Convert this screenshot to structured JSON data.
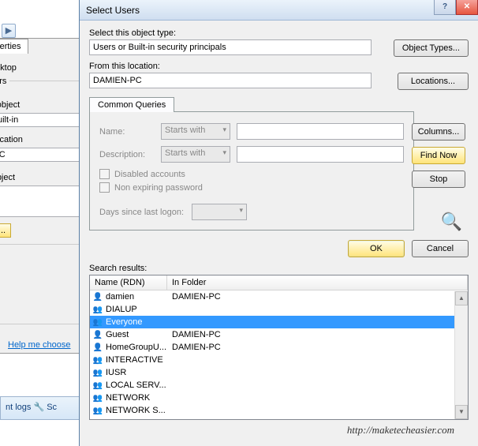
{
  "background": {
    "arrow": "▶",
    "sysprop_tab": "ystem Properties",
    "remote_label": "Remote Desktop",
    "select_users_group": "Select Users",
    "obj_label": "Select this object",
    "obj_value": "Users or Built-in",
    "loc_label": "From this location",
    "loc_value": "DAMIEN-PC",
    "enter_label": "Enter the object",
    "advanced_btn": "Advanced...",
    "help_link": "Help me choose",
    "logs_text": "nt logs     🔧 Sc"
  },
  "dialog": {
    "title": "Select Users",
    "object_type_label": "Select this object type:",
    "object_type_value": "Users or Built-in security principals",
    "object_types_btn": "Object Types...",
    "location_label": "From this location:",
    "location_value": "DAMIEN-PC",
    "locations_btn": "Locations...",
    "queries_tab": "Common Queries",
    "name_label": "Name:",
    "name_mode": "Starts with",
    "desc_label": "Description:",
    "desc_mode": "Starts with",
    "disabled_chk": "Disabled accounts",
    "nonexp_chk": "Non expiring password",
    "days_label": "Days since last logon:",
    "columns_btn": "Columns...",
    "findnow_btn": "Find Now",
    "stop_btn": "Stop",
    "ok_btn": "OK",
    "cancel_btn": "Cancel",
    "results_label": "Search results:",
    "col_name": "Name (RDN)",
    "col_folder": "In Folder",
    "rows": [
      {
        "icon": "user",
        "name": "damien",
        "folder": "DAMIEN-PC",
        "selected": false
      },
      {
        "icon": "group",
        "name": "DIALUP",
        "folder": "",
        "selected": false
      },
      {
        "icon": "group",
        "name": "Everyone",
        "folder": "",
        "selected": true
      },
      {
        "icon": "user",
        "name": "Guest",
        "folder": "DAMIEN-PC",
        "selected": false
      },
      {
        "icon": "user",
        "name": "HomeGroupU...",
        "folder": "DAMIEN-PC",
        "selected": false
      },
      {
        "icon": "group",
        "name": "INTERACTIVE",
        "folder": "",
        "selected": false
      },
      {
        "icon": "group",
        "name": "IUSR",
        "folder": "",
        "selected": false
      },
      {
        "icon": "group",
        "name": "LOCAL SERV...",
        "folder": "",
        "selected": false
      },
      {
        "icon": "group",
        "name": "NETWORK",
        "folder": "",
        "selected": false
      },
      {
        "icon": "group",
        "name": "NETWORK S...",
        "folder": "",
        "selected": false
      }
    ]
  },
  "watermark": "http://maketecheasier.com"
}
